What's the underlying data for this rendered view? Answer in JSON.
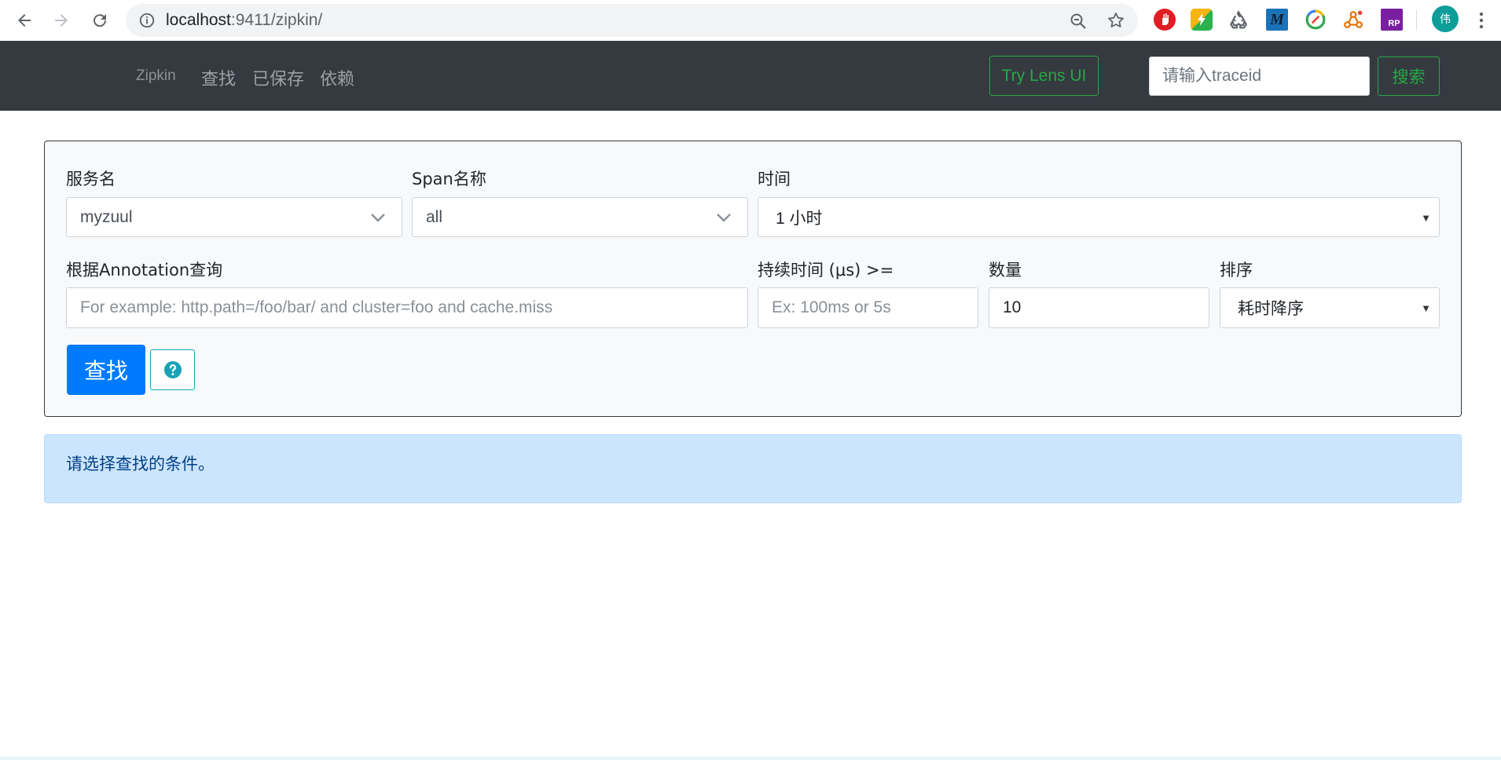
{
  "browser": {
    "url_host": "localhost",
    "url_path": ":9411/zipkin/",
    "avatar_text": "伟",
    "extensions": [
      "adblock-icon",
      "feedly-icon",
      "recycle-icon",
      "markdown-icon",
      "chrome-tool-icon",
      "network-icon",
      "rp-icon"
    ],
    "ext_labels": {
      "markdown": "M",
      "rp": "RP"
    }
  },
  "navbar": {
    "brand": "Zipkin",
    "links": [
      "查找",
      "已保存",
      "依赖"
    ],
    "lens_button": "Try Lens UI",
    "trace_placeholder": "请输入traceid",
    "search_button": "搜索"
  },
  "form": {
    "service_label": "服务名",
    "service_value": "myzuul",
    "span_label": "Span名称",
    "span_value": "all",
    "time_label": "时间",
    "time_value": "1 小时",
    "annotation_label": "根据Annotation查询",
    "annotation_placeholder": "For example: http.path=/foo/bar/ and cluster=foo and cache.miss",
    "duration_label": "持续时间 (μs) >=",
    "duration_placeholder": "Ex: 100ms or 5s",
    "limit_label": "数量",
    "limit_value": "10",
    "sort_label": "排序",
    "sort_value": "耗时降序",
    "find_button": "查找"
  },
  "alert": {
    "message": "请选择查找的条件。"
  },
  "colors": {
    "navbar_bg": "#343a40",
    "primary": "#007bff",
    "success": "#28a745",
    "info": "#17a2b8",
    "alert_bg": "#cce5ff"
  }
}
